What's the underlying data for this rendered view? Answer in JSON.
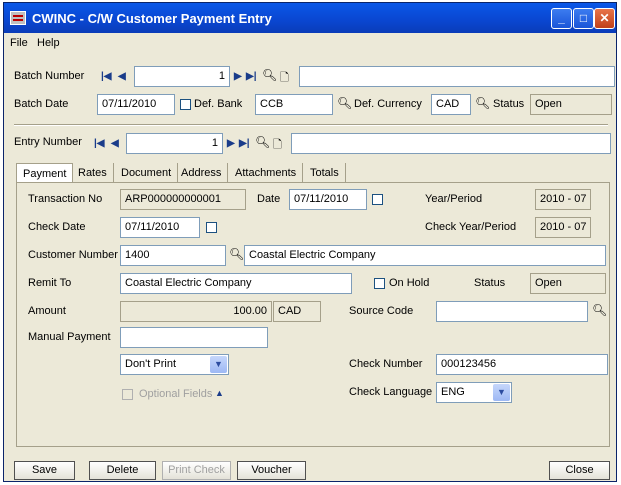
{
  "window": {
    "title": "CWINC - C/W Customer Payment Entry"
  },
  "menu": {
    "file": "File",
    "help": "Help"
  },
  "batch": {
    "number_label": "Batch Number",
    "number_value": "1",
    "description": "",
    "date_label": "Batch Date",
    "date_value": "07/11/2010",
    "def_bank_label": "Def. Bank",
    "def_bank_value": "CCB",
    "def_currency_label": "Def. Currency",
    "def_currency_value": "CAD",
    "status_label": "Status",
    "status_value": "Open"
  },
  "entry": {
    "number_label": "Entry Number",
    "number_value": "1",
    "description": ""
  },
  "tabs": [
    "Payment",
    "Rates",
    "Document",
    "Address",
    "Attachments",
    "Totals"
  ],
  "payment": {
    "transaction_no_label": "Transaction No",
    "transaction_no_value": "ARP000000000001",
    "date_label": "Date",
    "date_value": "07/11/2010",
    "year_period_label": "Year/Period",
    "year_period_value": "2010 - 07",
    "check_date_label": "Check Date",
    "check_date_value": "07/11/2010",
    "check_year_period_label": "Check Year/Period",
    "check_year_period_value": "2010 - 07",
    "customer_number_label": "Customer Number",
    "customer_number_value": "1400",
    "customer_name_value": "Coastal Electric Company",
    "remit_to_label": "Remit To",
    "remit_to_value": "Coastal Electric Company",
    "on_hold_label": "On Hold",
    "status_label": "Status",
    "status_value": "Open",
    "amount_label": "Amount",
    "amount_value": "100.00",
    "currency_value": "CAD",
    "source_code_label": "Source Code",
    "source_code_value": "",
    "manual_payment_label": "Manual Payment",
    "manual_payment_value": "",
    "print_option": "Don't Print",
    "check_number_label": "Check Number",
    "check_number_value": "000123456",
    "optional_fields_label": "Optional Fields",
    "check_language_label": "Check Language",
    "check_language_value": "ENG"
  },
  "buttons": {
    "save": "Save",
    "delete": "Delete",
    "print_check": "Print Check",
    "voucher": "Voucher",
    "close": "Close"
  },
  "colors": {
    "title_bar": "#0a46d0",
    "window_bg": "#ece9d8",
    "field_border": "#7f9db9"
  }
}
